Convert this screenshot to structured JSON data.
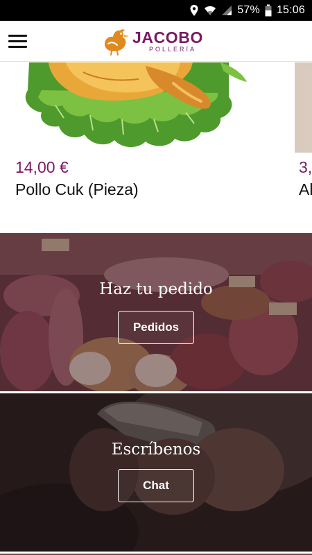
{
  "status_bar": {
    "battery_percent": "57%",
    "time": "15:06",
    "icons": [
      "location-icon",
      "wifi-icon",
      "signal-icon",
      "battery-icon"
    ]
  },
  "header": {
    "menu_icon": "hamburger-menu-icon",
    "logo_name": "JACOBO",
    "logo_subtitle": "POLLERÍA"
  },
  "products": [
    {
      "price": "14,00 €",
      "name": "Pollo Cuk (Pieza)"
    },
    {
      "price": "3,",
      "name": "Al"
    }
  ],
  "banners": [
    {
      "title": "Haz tu pedido",
      "button": "Pedidos"
    },
    {
      "title": "Escríbenos",
      "button": "Chat"
    }
  ],
  "colors": {
    "brand": "#7b1a62",
    "logo_bird": "#e08a1e"
  }
}
